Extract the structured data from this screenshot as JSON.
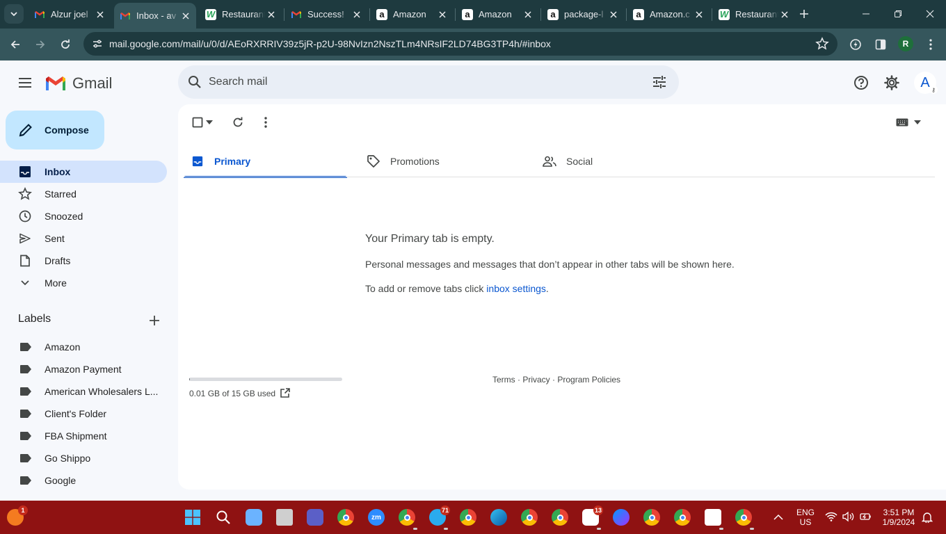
{
  "browser": {
    "tabs": [
      {
        "title": "Alzur joel",
        "favicon": "gmail-icon",
        "active": false
      },
      {
        "title": "Inbox - av",
        "favicon": "gmail-icon",
        "active": true
      },
      {
        "title": "Restaurant",
        "favicon": "wix-icon",
        "active": false
      },
      {
        "title": "Success!",
        "favicon": "gmail-icon",
        "active": false
      },
      {
        "title": "Amazon",
        "favicon": "amazon-icon",
        "active": false
      },
      {
        "title": "Amazon",
        "favicon": "amazon-icon",
        "active": false
      },
      {
        "title": "package-l",
        "favicon": "amazon-icon",
        "active": false
      },
      {
        "title": "Amazon.c",
        "favicon": "amazon-icon",
        "active": false
      },
      {
        "title": "Restaurant",
        "favicon": "wix-icon",
        "active": false
      }
    ],
    "url": "mail.google.com/mail/u/0/d/AEoRXRRIV39z5jR-p2U-98NvIzn2NszTLm4NRsIF2LD74BG3TP4h/#inbox",
    "profile_initial": "R"
  },
  "gmail": {
    "logo_text": "Gmail",
    "search_placeholder": "Search mail",
    "avatar_initial": "A",
    "compose_label": "Compose",
    "nav": [
      {
        "label": "Inbox",
        "icon": "inbox-icon",
        "active": true
      },
      {
        "label": "Starred",
        "icon": "star-icon",
        "active": false
      },
      {
        "label": "Snoozed",
        "icon": "clock-icon",
        "active": false
      },
      {
        "label": "Sent",
        "icon": "send-icon",
        "active": false
      },
      {
        "label": "Drafts",
        "icon": "draft-icon",
        "active": false
      },
      {
        "label": "More",
        "icon": "chevron-down-icon",
        "active": false
      }
    ],
    "labels_header": "Labels",
    "labels": [
      "Amazon",
      "Amazon Payment",
      "American Wholesalers L...",
      "Client's Folder",
      "FBA Shipment",
      "Go Shippo",
      "Google"
    ],
    "category_tabs": [
      {
        "label": "Primary",
        "icon": "inbox-icon",
        "active": true
      },
      {
        "label": "Promotions",
        "icon": "tag-icon",
        "active": false
      },
      {
        "label": "Social",
        "icon": "people-icon",
        "active": false
      }
    ],
    "empty_state": {
      "title": "Your Primary tab is empty.",
      "description": "Personal messages and messages that don’t appear in other tabs will be shown here.",
      "settings_prefix": "To add or remove tabs click ",
      "settings_link": "inbox settings",
      "settings_suffix": "."
    },
    "storage": {
      "text": "0.01 GB of 15 GB used",
      "used_fraction": 0.001
    },
    "footer": {
      "terms": "Terms",
      "privacy": "Privacy",
      "policies": "Program Policies",
      "separator": " · "
    }
  },
  "taskbar": {
    "icons": [
      {
        "name": "fox-app-icon",
        "badge": "1"
      },
      {
        "name": "windows-start-icon"
      },
      {
        "name": "search-icon"
      },
      {
        "name": "copilot-icon"
      },
      {
        "name": "task-view-icon"
      },
      {
        "name": "teams-meet-icon"
      },
      {
        "name": "chrome-icon"
      },
      {
        "name": "zoom-icon"
      },
      {
        "name": "chrome-icon"
      },
      {
        "name": "telegram-icon",
        "badge": "71"
      },
      {
        "name": "chrome-icon"
      },
      {
        "name": "edge-icon"
      },
      {
        "name": "chrome-icon"
      },
      {
        "name": "chrome-icon"
      },
      {
        "name": "slack-icon",
        "badge": "13"
      },
      {
        "name": "messenger-icon"
      },
      {
        "name": "chrome-icon"
      },
      {
        "name": "chrome-icon"
      },
      {
        "name": "snipping-tool-icon"
      },
      {
        "name": "chrome-icon"
      }
    ],
    "lang_top": "ENG",
    "lang_bottom": "US",
    "time": "3:51 PM",
    "date": "1/9/2024"
  },
  "colors": {
    "tabbar": "#1e3a3f",
    "toolbar": "#35565c",
    "taskbar": "#8f1212",
    "accent": "#0b57d0",
    "compose": "#c2e7ff",
    "active_nav": "#d3e3fd"
  }
}
